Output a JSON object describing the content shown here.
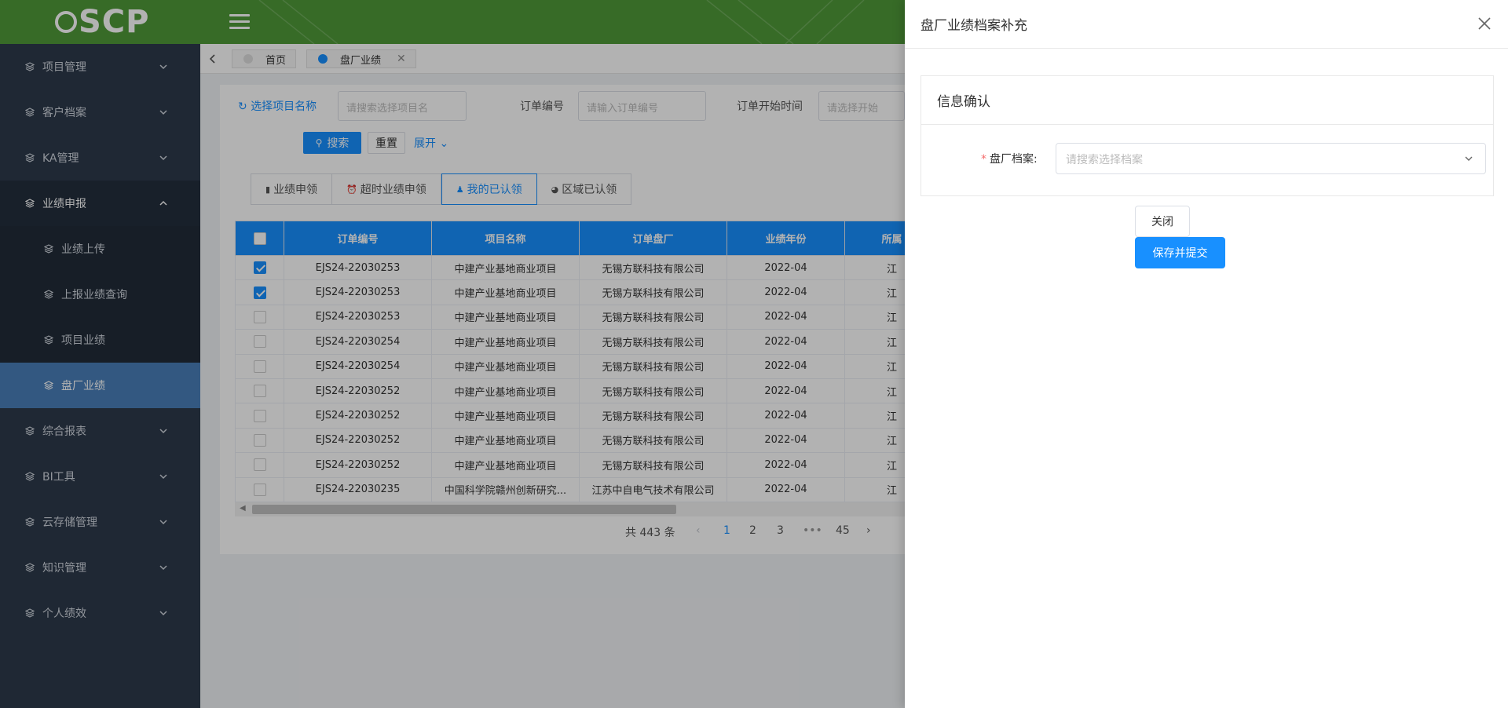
{
  "header": {
    "logo_text": "SCP"
  },
  "sidebar": {
    "items": [
      {
        "label": "项目管理"
      },
      {
        "label": "客户档案"
      },
      {
        "label": "KA管理"
      },
      {
        "label": "业绩申报"
      },
      {
        "label": "综合报表"
      },
      {
        "label": "BI工具"
      },
      {
        "label": "云存储管理"
      },
      {
        "label": "知识管理"
      },
      {
        "label": "个人绩效"
      }
    ],
    "sub_items": [
      {
        "label": "业绩上传"
      },
      {
        "label": "上报业绩查询"
      },
      {
        "label": "项目业绩"
      },
      {
        "label": "盘厂业绩"
      }
    ]
  },
  "tabs": [
    {
      "label": "首页"
    },
    {
      "label": "盘厂业绩",
      "close": "✕"
    }
  ],
  "filters": {
    "project_link": "选择项目名称",
    "project_placeholder": "请搜索选择项目名",
    "order_label": "订单编号",
    "order_placeholder": "请输入订单编号",
    "start_label": "订单开始时间",
    "start_placeholder": "请选择开始",
    "search": "搜索",
    "reset": "重置",
    "expand": "展开"
  },
  "segments": [
    "业绩申领",
    "超时业绩申领",
    "我的已认领",
    "区域已认领"
  ],
  "table": {
    "headers": [
      "订单编号",
      "项目名称",
      "订单盘厂",
      "业绩年份",
      "所属"
    ],
    "rows": [
      {
        "checked": true,
        "order": "EJS24-22030253",
        "project": "中建产业基地商业项目",
        "factory": "无锡方联科技有限公司",
        "year": "2022-04",
        "region": "江"
      },
      {
        "checked": true,
        "order": "EJS24-22030253",
        "project": "中建产业基地商业项目",
        "factory": "无锡方联科技有限公司",
        "year": "2022-04",
        "region": "江"
      },
      {
        "checked": false,
        "order": "EJS24-22030253",
        "project": "中建产业基地商业项目",
        "factory": "无锡方联科技有限公司",
        "year": "2022-04",
        "region": "江"
      },
      {
        "checked": false,
        "order": "EJS24-22030254",
        "project": "中建产业基地商业项目",
        "factory": "无锡方联科技有限公司",
        "year": "2022-04",
        "region": "江"
      },
      {
        "checked": false,
        "order": "EJS24-22030254",
        "project": "中建产业基地商业项目",
        "factory": "无锡方联科技有限公司",
        "year": "2022-04",
        "region": "江"
      },
      {
        "checked": false,
        "order": "EJS24-22030252",
        "project": "中建产业基地商业项目",
        "factory": "无锡方联科技有限公司",
        "year": "2022-04",
        "region": "江"
      },
      {
        "checked": false,
        "order": "EJS24-22030252",
        "project": "中建产业基地商业项目",
        "factory": "无锡方联科技有限公司",
        "year": "2022-04",
        "region": "江"
      },
      {
        "checked": false,
        "order": "EJS24-22030252",
        "project": "中建产业基地商业项目",
        "factory": "无锡方联科技有限公司",
        "year": "2022-04",
        "region": "江"
      },
      {
        "checked": false,
        "order": "EJS24-22030252",
        "project": "中建产业基地商业项目",
        "factory": "无锡方联科技有限公司",
        "year": "2022-04",
        "region": "江"
      },
      {
        "checked": false,
        "order": "EJS24-22030235",
        "project": "中国科学院赣州创新研究...",
        "factory": "江苏中自电气技术有限公司",
        "year": "2022-04",
        "region": "江"
      }
    ]
  },
  "pager": {
    "total": "共 443 条",
    "pages": [
      "1",
      "2",
      "3",
      "•••",
      "45"
    ],
    "prev": "‹",
    "next": "›"
  },
  "drawer": {
    "title": "盘厂业绩档案补充",
    "card_title": "信息确认",
    "field_label": "盘厂档案:",
    "required_mark": "*",
    "field_placeholder": "请搜索选择档案",
    "close_button": "关闭",
    "submit_button": "保存并提交"
  },
  "colors": {
    "header": "#4f9a38",
    "sidebar": "#2d3a4b",
    "accent": "#1890ff"
  }
}
